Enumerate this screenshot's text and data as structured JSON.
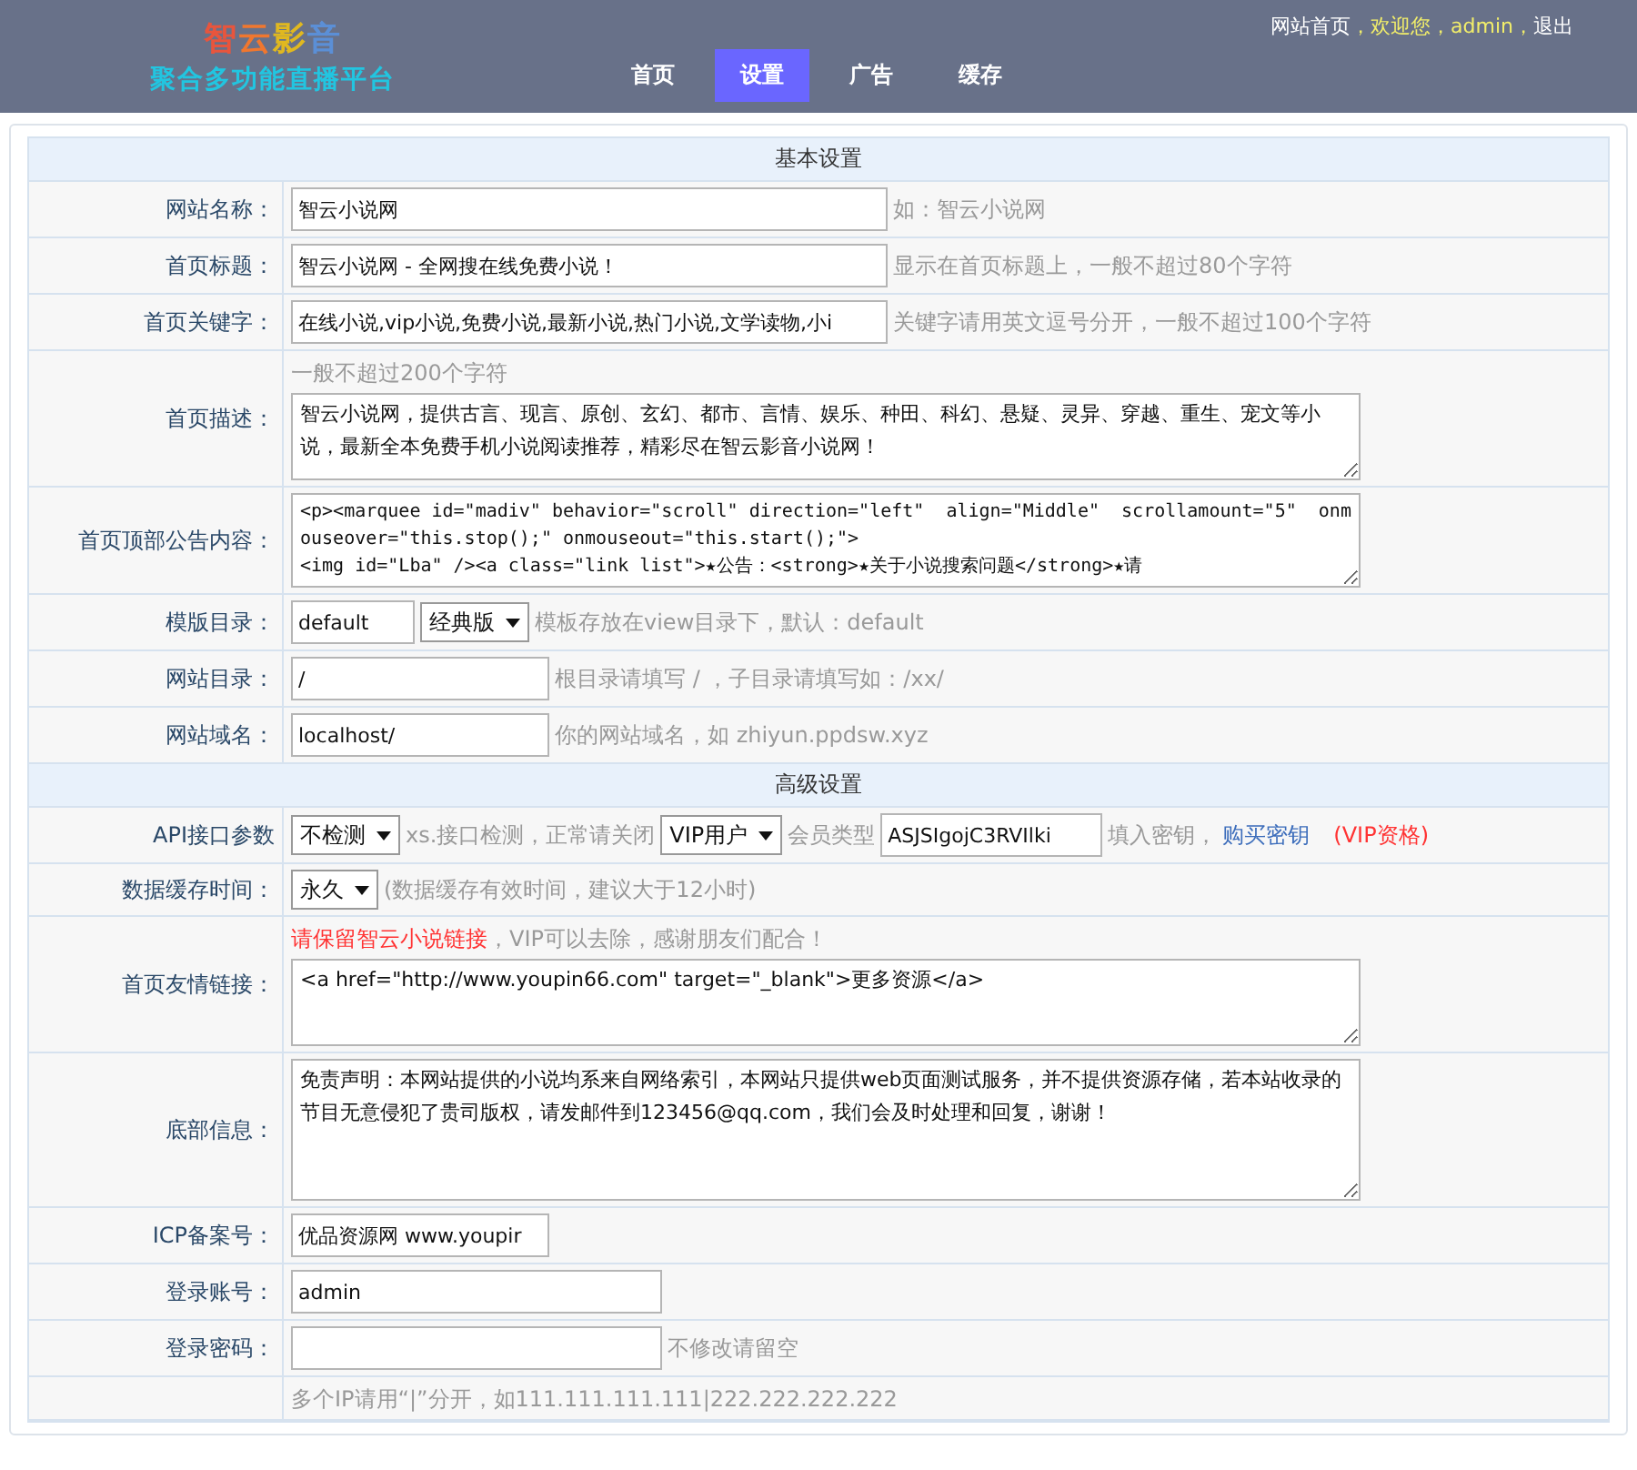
{
  "header": {
    "logo": [
      {
        "text": "智",
        "color": "#e8553d"
      },
      {
        "text": "云",
        "color": "#f0772f"
      },
      {
        "text": "影",
        "color": "#e0b820"
      },
      {
        "text": "音",
        "color": "#5b8fd6"
      }
    ],
    "subtitle": "聚合多功能直播平台",
    "tabs": [
      {
        "label": "首页",
        "selected": false
      },
      {
        "label": "设置",
        "selected": true
      },
      {
        "label": "广告",
        "selected": false
      },
      {
        "label": "缓存",
        "selected": false
      }
    ],
    "user_bar": [
      {
        "kind": "link",
        "text": "网站首页"
      },
      {
        "kind": "greet",
        "text": "，欢迎您，admin，"
      },
      {
        "kind": "link",
        "text": "退出"
      }
    ]
  },
  "rows": [
    {
      "kind": "section",
      "title": "基本设置"
    },
    {
      "kind": "field",
      "label": "网站名称：",
      "controls": [
        {
          "kind": "longinput",
          "value": "智云小说网"
        },
        {
          "kind": "hint",
          "text": "如：智云小说网"
        }
      ]
    },
    {
      "kind": "field",
      "label": "首页标题：",
      "controls": [
        {
          "kind": "longinput",
          "value": "智云小说网 - 全网搜在线免费小说！"
        },
        {
          "kind": "hint",
          "text": "显示在首页标题上，一般不超过80个字符"
        }
      ]
    },
    {
      "kind": "field",
      "label": "首页关键字：",
      "controls": [
        {
          "kind": "longinput",
          "value": "在线小说,vip小说,免费小说,最新小说,热门小说,文学读物,小i"
        },
        {
          "kind": "hint",
          "text": "关键字请用英文逗号分开，一般不超过100个字符"
        }
      ]
    },
    {
      "kind": "field",
      "label": "首页描述：",
      "above": [
        {
          "kind": "hint",
          "text": "一般不超过200个字符"
        }
      ],
      "controls": [
        {
          "kind": "textarea",
          "value": "智云小说网，提供古言、现言、原创、玄幻、都市、言情、娱乐、种田、科幻、悬疑、灵异、穿越、重生、宠文等小说，最新全本免费手机小说阅读推荐，精彩尽在智云影音小说网！"
        }
      ]
    },
    {
      "kind": "field",
      "label": "首页顶部公告内容：",
      "controls": [
        {
          "kind": "code",
          "value": "<p><marquee id=\"madiv\" behavior=\"scroll\" direction=\"left\"  align=\"Middle\"  scrollamount=\"5\"  onmouseover=\"this.stop();\" onmouseout=\"this.start();\">\n<img id=\"Lba\" /><a class=\"link list\">★公告：<strong>★关于小说搜索问题</strong>★请"
        }
      ]
    },
    {
      "kind": "field",
      "label": "模版目录：",
      "controls": [
        {
          "kind": "tinyinput",
          "value": "default"
        },
        {
          "kind": "select",
          "value": "经典版"
        },
        {
          "kind": "hint",
          "text": "模板存放在view目录下，默认：default"
        }
      ]
    },
    {
      "kind": "field",
      "label": "网站目录：",
      "controls": [
        {
          "kind": "input",
          "value": "/"
        },
        {
          "kind": "hint",
          "text": "根目录请填写 / ，子目录请填写如：/xx/"
        }
      ]
    },
    {
      "kind": "field",
      "label": "网站域名：",
      "controls": [
        {
          "kind": "input",
          "value": "localhost/"
        },
        {
          "kind": "hint",
          "text": "你的网站域名，如 zhiyun.ppdsw.xyz"
        }
      ]
    },
    {
      "kind": "section",
      "title": "高级设置"
    },
    {
      "kind": "field",
      "label": "API接口参数",
      "controls": [
        {
          "kind": "select",
          "value": "不检测"
        },
        {
          "kind": "hint",
          "text": "xs.接口检测，正常请关闭"
        },
        {
          "kind": "select",
          "value": "VIP用户"
        },
        {
          "kind": "hint",
          "text": "会员类型"
        },
        {
          "kind": "keyinput",
          "value": "ASJSIgojC3RVIlki"
        },
        {
          "kind": "hint",
          "text": "填入密钥，"
        },
        {
          "kind": "link",
          "text": "购买密钥"
        },
        {
          "kind": "alert",
          "text": "(VIP资格)"
        }
      ]
    },
    {
      "kind": "field",
      "label": "数据缓存时间：",
      "controls": [
        {
          "kind": "select",
          "value": "永久"
        },
        {
          "kind": "hint",
          "text": "(数据缓存有效时间，建议大于12小时)"
        }
      ]
    },
    {
      "kind": "field",
      "label": "首页友情链接：",
      "above": [
        {
          "kind": "alert",
          "text": "请保留智云小说链接"
        },
        {
          "kind": "hint",
          "text": "，VIP可以去除，感谢朋友们配合！"
        }
      ],
      "controls": [
        {
          "kind": "textarea",
          "value": "<a href=\"http://www.youpin66.com\" target=\"_blank\">更多资源</a>"
        }
      ]
    },
    {
      "kind": "field",
      "label": "底部信息：",
      "controls": [
        {
          "kind": "bigtextarea",
          "value": "免责声明：本网站提供的小说均系来自网络索引，本网站只提供web页面测试服务，并不提供资源存储，若本站收录的节目无意侵犯了贵司版权，请发邮件到123456@qq.com，我们会及时处理和回复，谢谢！"
        }
      ]
    },
    {
      "kind": "field",
      "label": "ICP备案号：",
      "controls": [
        {
          "kind": "input",
          "value": "优品资源网 www.youpir"
        }
      ]
    },
    {
      "kind": "field",
      "label": "登录账号：",
      "controls": [
        {
          "kind": "midinput",
          "value": "admin"
        }
      ]
    },
    {
      "kind": "field",
      "label": "登录密码：",
      "controls": [
        {
          "kind": "midinput"
        },
        {
          "kind": "hint",
          "text": "不修改请留空"
        }
      ]
    },
    {
      "kind": "field",
      "label": "",
      "above": [
        {
          "kind": "hint",
          "text": "多个IP请用“|”分开，如111.111.111.111|222.222.222.222"
        }
      ],
      "controls": []
    }
  ]
}
